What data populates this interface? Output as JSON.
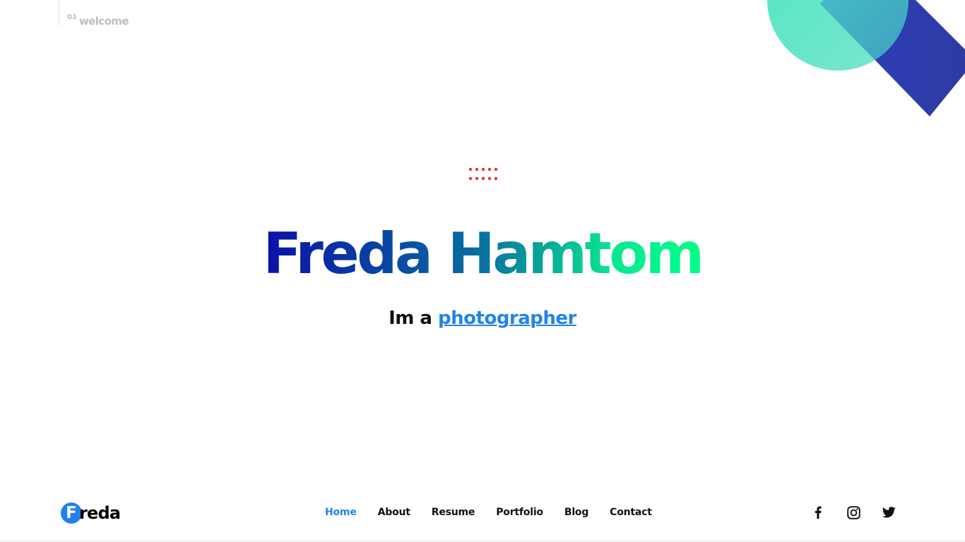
{
  "section": {
    "number": "01",
    "label": "welcome"
  },
  "hero": {
    "name": "Freda Hamtom",
    "tagline_prefix": "Im a",
    "role": "photographer"
  },
  "colors": {
    "accent": "#2384e8",
    "dots": "#e03535",
    "gradient_start": "#0a10a8",
    "gradient_end": "#00ff88",
    "circle": "#5ee6c6",
    "diamond": "#2430b8"
  },
  "logo": {
    "initial": "F",
    "rest": "reda"
  },
  "nav": {
    "items": [
      {
        "label": "Home",
        "active": true
      },
      {
        "label": "About",
        "active": false
      },
      {
        "label": "Resume",
        "active": false
      },
      {
        "label": "Portfolio",
        "active": false
      },
      {
        "label": "Blog",
        "active": false
      },
      {
        "label": "Contact",
        "active": false
      }
    ]
  },
  "social": [
    "facebook-icon",
    "instagram-icon",
    "twitter-icon"
  ]
}
